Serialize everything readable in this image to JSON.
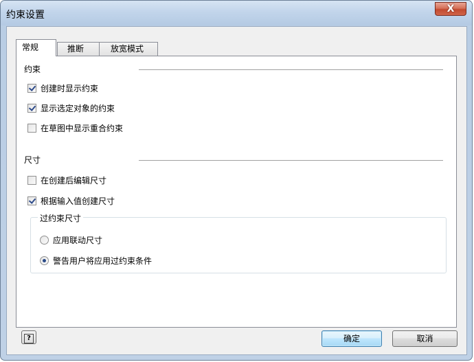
{
  "window": {
    "title": "约束设置",
    "close_glyph": "X"
  },
  "tabs": [
    {
      "label": "常规",
      "active": true
    },
    {
      "label": "推断",
      "active": false
    },
    {
      "label": "放宽模式",
      "active": false
    }
  ],
  "constraints": {
    "heading": "约束",
    "options": [
      {
        "label": "创建时显示约束",
        "checked": true
      },
      {
        "label": "显示选定对象的约束",
        "checked": true
      },
      {
        "label": "在草图中显示重合约束",
        "checked": false
      }
    ]
  },
  "dimensions": {
    "heading": "尺寸",
    "options": [
      {
        "label": "在创建后编辑尺寸",
        "checked": false
      },
      {
        "label": "根据输入值创建尺寸",
        "checked": true
      }
    ],
    "over_constrained": {
      "label": "过约束尺寸",
      "options": [
        {
          "label": "应用联动尺寸",
          "selected": false
        },
        {
          "label": "警告用户将应用过约束条件",
          "selected": true
        }
      ]
    }
  },
  "footer": {
    "help_glyph": "?",
    "ok_label": "确定",
    "cancel_label": "取消"
  },
  "colors": {
    "title_bar": "#c2d5eb",
    "close_button": "#c24a2f",
    "default_button": "#bee6fd",
    "check_mark": "#2d4a8a"
  }
}
